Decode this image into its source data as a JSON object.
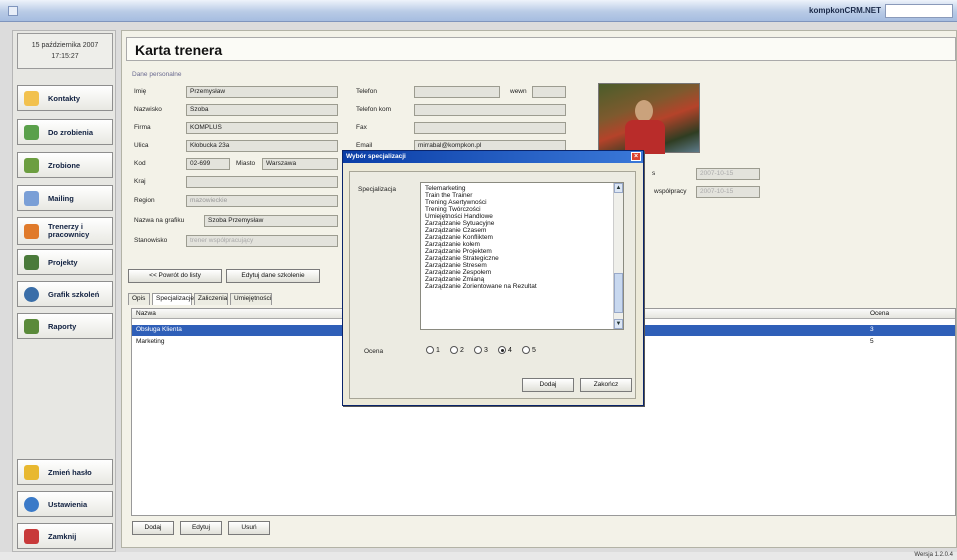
{
  "app": {
    "brand": "kompkonCRM.NET",
    "version": "Wersja 1.2.0.4"
  },
  "sidebar": {
    "date": "15 października 2007",
    "time": "17:15:27",
    "items": [
      {
        "label": "Kontakty",
        "icon": "contacts-icon",
        "color": "#f2c14e"
      },
      {
        "label": "Do zrobienia",
        "icon": "todo-icon",
        "color": "#5aa04a"
      },
      {
        "label": "Zrobione",
        "icon": "done-icon",
        "color": "#6c9e40"
      },
      {
        "label": "Mailing",
        "icon": "mailing-icon",
        "color": "#7a9fd6"
      },
      {
        "label": "Trenerzy i pracownicy",
        "icon": "trainers-icon",
        "color": "#e07a2a"
      },
      {
        "label": "Projekty",
        "icon": "projects-icon",
        "color": "#4a7a3a"
      },
      {
        "label": "Grafik szkoleń",
        "icon": "schedule-icon",
        "color": "#3a6ea8"
      },
      {
        "label": "Raporty",
        "icon": "reports-icon",
        "color": "#5a8a3a"
      },
      {
        "label": "Zmień hasło",
        "icon": "key-icon",
        "color": "#e8b830"
      },
      {
        "label": "Ustawienia",
        "icon": "settings-icon",
        "color": "#3a7ac8"
      },
      {
        "label": "Zamknij",
        "icon": "close-app-icon",
        "color": "#c83a3a"
      }
    ]
  },
  "form": {
    "title": "Karta trenera",
    "section_label": "Dane personalne",
    "labels": {
      "imie": "Imię",
      "nazwisko": "Nazwisko",
      "firma": "Firma",
      "ulica": "Ulica",
      "kod": "Kod",
      "miasto": "Miasto",
      "kraj": "Kraj",
      "region": "Region",
      "nazwa_grafik": "Nazwa na grafiku",
      "stanowisko": "Stanowisko",
      "telefon": "Telefon",
      "wewn": "wewn",
      "telefon_kom": "Telefon kom",
      "fax": "Fax",
      "email": "Email",
      "wspolpracy": "współpracy",
      "status_short": "s"
    },
    "values": {
      "imie": "Przemysław",
      "nazwisko": "Szoba",
      "firma": "KOMPLUS",
      "ulica": "Kłobucka 23a",
      "kod": "02-699",
      "miasto": "Warszawa",
      "kraj": "",
      "region": "mazowieckie",
      "nazwa_grafik": "Szoba Przemysław",
      "stanowisko": "trener współpracujący",
      "telefon": "",
      "wewn": "",
      "telefon_kom": "",
      "fax": "",
      "email": "mirrabal@kompkon.pl",
      "date1": "2007-10-15",
      "date2": "2007-10-15"
    },
    "buttons": {
      "back": "<< Powrót do listy",
      "edit": "Edytuj dane szkolenie"
    }
  },
  "tabs": [
    "Opis",
    "Specjalizacje",
    "Zaliczenia",
    "Umiejętności"
  ],
  "grid": {
    "columns": [
      "Nazwa",
      "Ocena"
    ],
    "rows": [
      {
        "name": "Obsługa Klienta",
        "score": "3"
      },
      {
        "name": "Marketing",
        "score": "5"
      }
    ]
  },
  "bottom_buttons": {
    "add": "Dodaj",
    "edit": "Edytuj",
    "delete": "Usuń"
  },
  "dialog": {
    "title": "Wybór specjalizacji",
    "spec_label": "Specjalizacja",
    "ocena_label": "Ocena",
    "items": [
      "Telemarketing",
      "Train the Trainer",
      "Trening Asertywności",
      "Trening Twórczości",
      "Umiejętności Handlowe",
      "Zarządzanie Sytuacyjne",
      "Zarządzanie Czasem",
      "Zarządzanie Konfliktem",
      "Zarządzanie kołem",
      "Zarządzanie Projektem",
      "Zarządzanie Strategiczne",
      "Zarządzanie Stresem",
      "Zarządzanie Zespołem",
      "Zarządzanie Zmianą",
      "Zarządzanie Zorientowane na Rezultat"
    ],
    "ratings": [
      "1",
      "2",
      "3",
      "4",
      "5"
    ],
    "selected_rating": "4",
    "buttons": {
      "add": "Dodaj",
      "close": "Zakończ"
    }
  }
}
